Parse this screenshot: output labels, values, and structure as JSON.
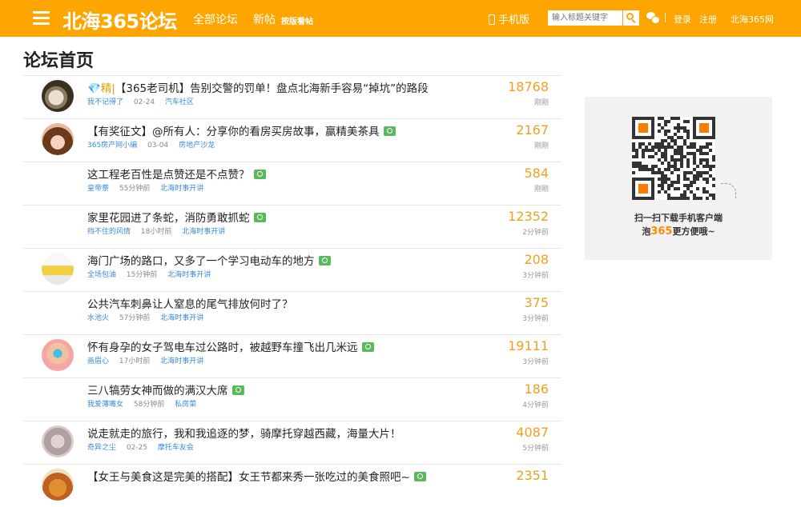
{
  "header": {
    "logo": "北海365论坛",
    "nav": [
      "全部论坛",
      "新帖"
    ],
    "nav_small": "按版看帖",
    "mobile": "手机版",
    "search_placeholder": "输入标题关键字",
    "login": "登录",
    "register": "注册",
    "site": "北海365网",
    "accent_color": "#ffa500"
  },
  "page_title": "论坛首页",
  "threads": [
    {
      "gem": "💎",
      "elite": "精",
      "title": "【365老司机】告别交警的罚单！盘点北海新手容易“掉坑”的路段",
      "has_photo": false,
      "author": "我不记得了",
      "time": "02-24",
      "board": "汽车社区",
      "count": "18768",
      "ago": "刚刚",
      "avatar": "cat-photo"
    },
    {
      "title": "【有奖征文】@所有人：分享你的看房买房故事，赢精美茶具",
      "has_photo": true,
      "author": "365房产网小编",
      "time": "03-04",
      "board": "房地产沙龙",
      "count": "2167",
      "ago": "刚刚",
      "avatar": "girl-photo"
    },
    {
      "title": "这工程老百性是点赞还是不点赞？",
      "has_photo": true,
      "author": "皇帝萘",
      "time": "55分钟前",
      "board": "北海时事开讲",
      "count": "584",
      "ago": "刚刚",
      "avatar": ""
    },
    {
      "title": "家里花园进了条蛇，消防勇敢抓蛇",
      "has_photo": true,
      "author": "挡不住的风情",
      "time": "18小时前",
      "board": "北海时事开讲",
      "count": "12352",
      "ago": "2分钟前",
      "avatar": ""
    },
    {
      "title": "海门广场的路口，又多了一个学习电动车的地方",
      "has_photo": true,
      "author": "全场包油",
      "time": "15分钟前",
      "board": "北海时事开讲",
      "count": "208",
      "ago": "3分钟前",
      "avatar": "bowl-photo"
    },
    {
      "title": "公共汽车刺鼻让人窒息的尾气排放何时了？",
      "has_photo": false,
      "author": "水池火",
      "time": "57分钟前",
      "board": "北海时事开讲",
      "count": "375",
      "ago": "3分钟前",
      "avatar": ""
    },
    {
      "title": "怀有身孕的女子驾电车过公路时，被越野车撞飞出几米远",
      "has_photo": true,
      "author": "画眉心",
      "time": "17小时前",
      "board": "北海时事开讲",
      "count": "19111",
      "ago": "3分钟前",
      "avatar": "sunglasses-photo"
    },
    {
      "title": "三八犒劳女神而做的满汉大席",
      "has_photo": true,
      "author": "我爱薄嘴女",
      "time": "58分钟前",
      "board": "私房菜",
      "count": "186",
      "ago": "4分钟前",
      "avatar": ""
    },
    {
      "title": "说走就走的旅行，我和我追逐的梦，骑摩托穿越西藏，海量大片！",
      "has_photo": false,
      "author": "奇异之尘",
      "time": "02-25",
      "board": "摩托车友会",
      "count": "4087",
      "ago": "5分钟前",
      "avatar": "hand-photo"
    },
    {
      "title": "【女王与美食这是完美的搭配】女王节都来秀一张吃过的美食照吧~",
      "has_photo": true,
      "author": "",
      "time": "",
      "board": "",
      "count": "2351",
      "ago": "",
      "avatar": "food-photo"
    }
  ],
  "sidebar": {
    "qr_line1": "扫一扫下载手机客户端",
    "qr_line2_pre": "泡",
    "qr_line2_num": "365",
    "qr_line2_post": "更方便哦~"
  }
}
